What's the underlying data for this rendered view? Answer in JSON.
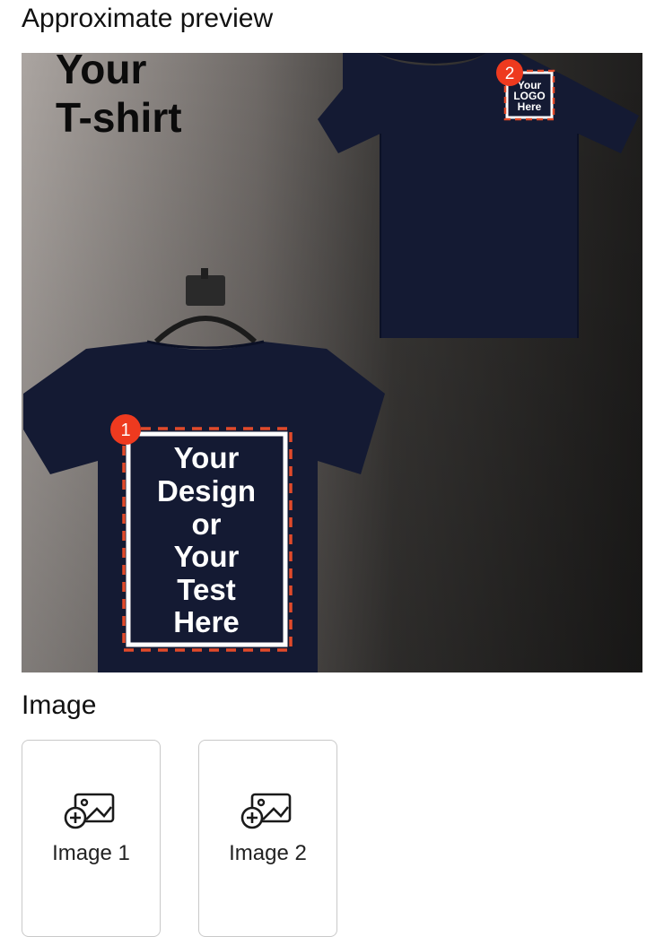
{
  "header": {
    "title": "Approximate preview"
  },
  "preview": {
    "headline_line1": "Your",
    "headline_line2": "T-shirt",
    "zone1": {
      "marker": "1",
      "lines": [
        "Your",
        "Design",
        "or",
        "Your",
        "Test",
        "Here"
      ]
    },
    "zone2": {
      "marker": "2",
      "lines": [
        "Your",
        "LOGO",
        "Here"
      ]
    },
    "colors": {
      "shirt": "#141a33",
      "accent_dash": "#e24a2a",
      "marker_bg": "#ee3a1f",
      "bg_light": "#aaa4a0",
      "bg_dark": "#232221"
    }
  },
  "image_section": {
    "title": "Image",
    "slots": [
      {
        "label": "Image 1",
        "icon": "add-image-icon"
      },
      {
        "label": "Image 2",
        "icon": "add-image-icon"
      }
    ]
  }
}
